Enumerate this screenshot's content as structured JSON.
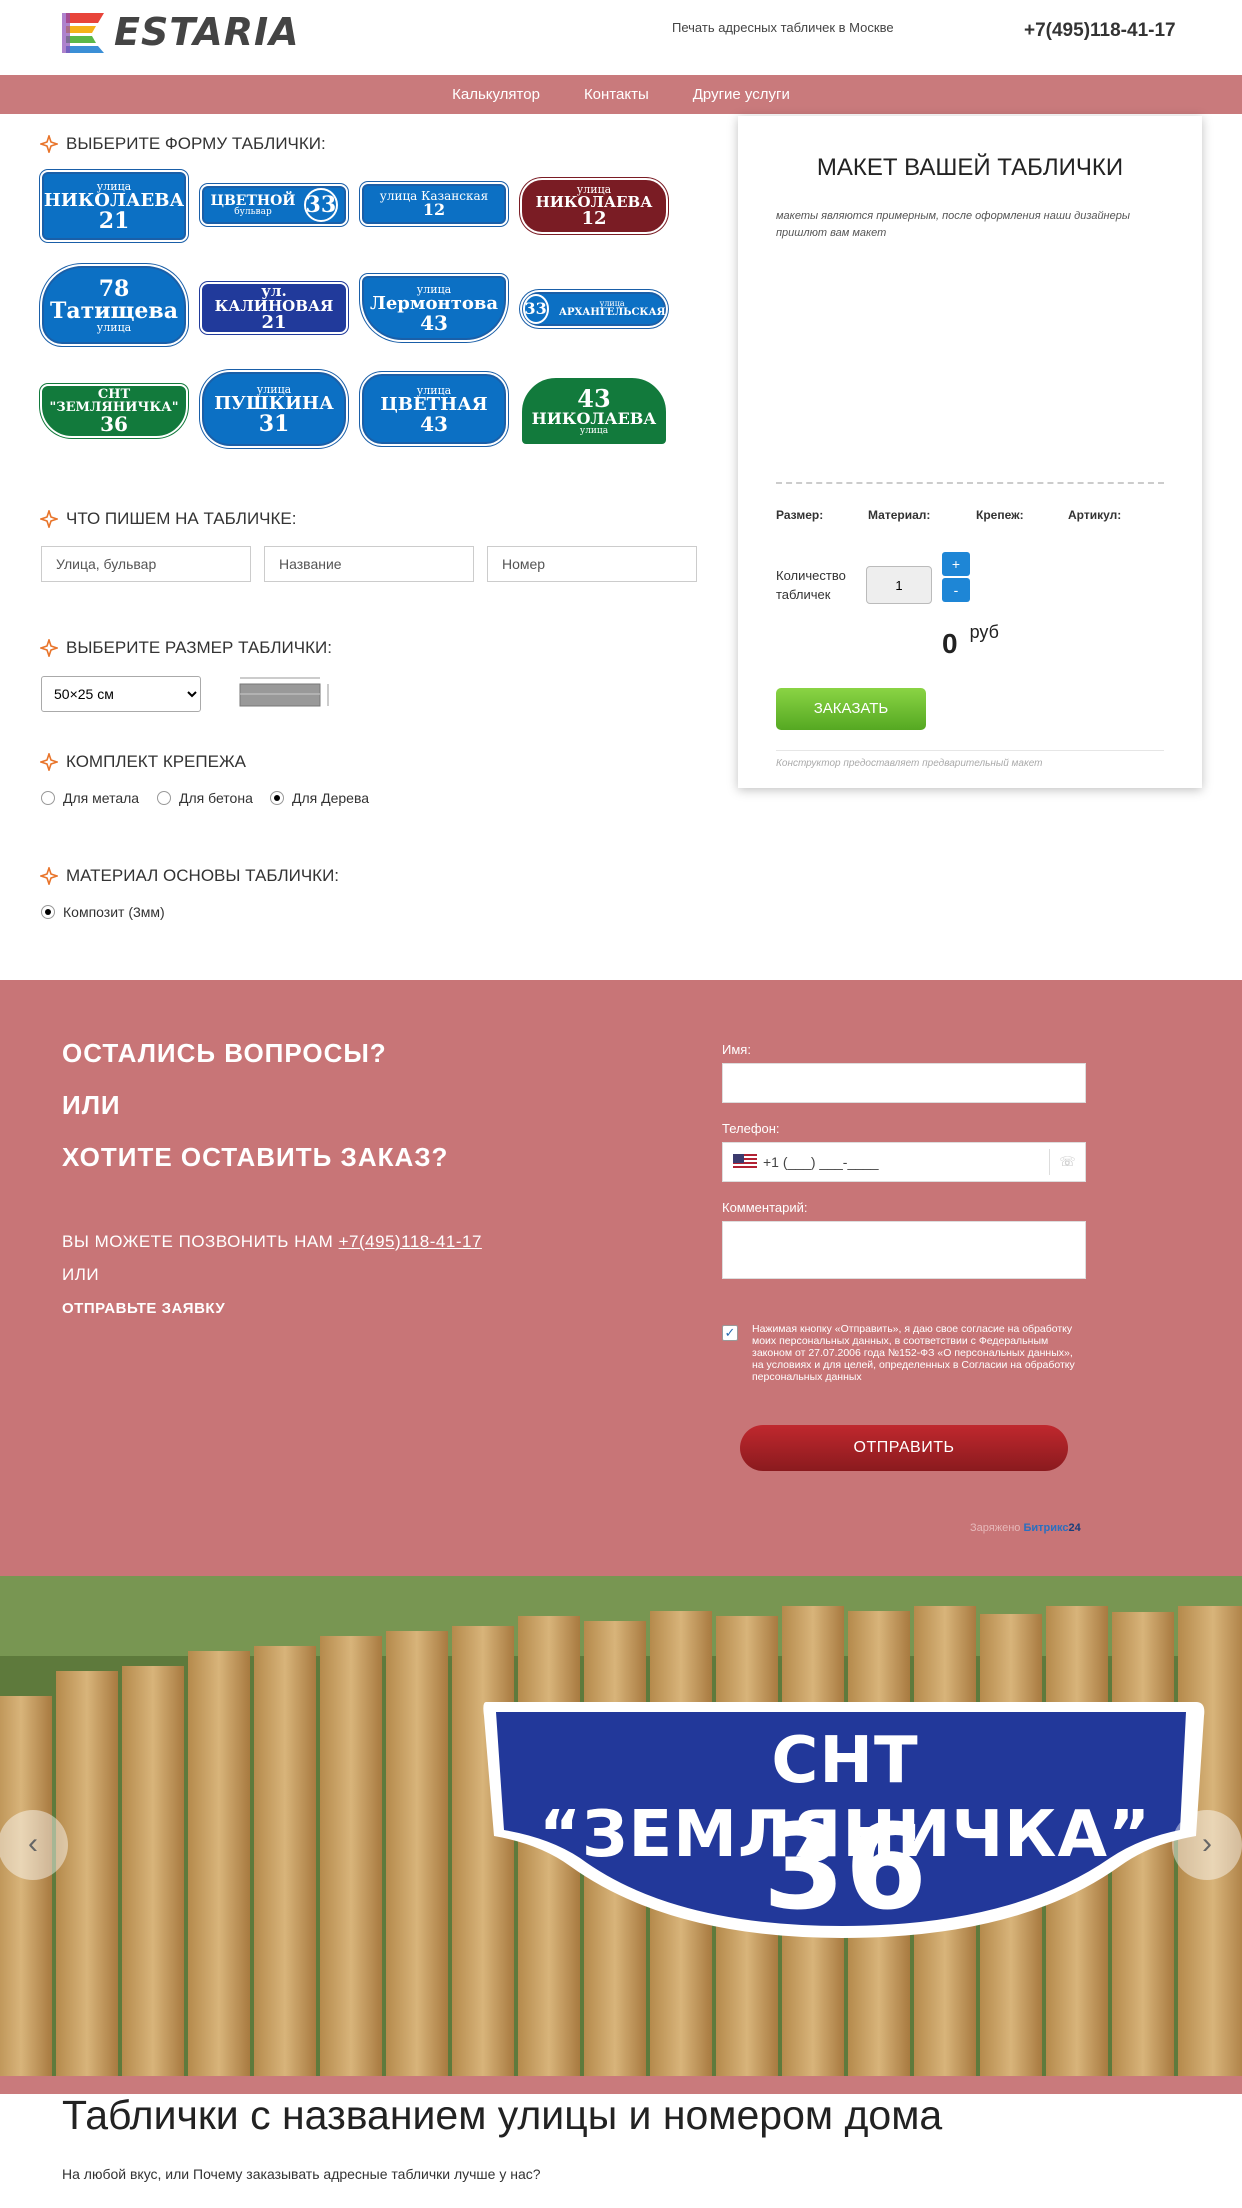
{
  "header": {
    "logo_text": "ESTARIA",
    "tagline": "Печать адресных табличек в Москве",
    "phone": "+7(495)118-41-17"
  },
  "nav": {
    "items": [
      "Калькулятор",
      "Контакты",
      "Другие услуги"
    ]
  },
  "shape_section": {
    "title": "ВЫБЕРИТЕ ФОРМУ ТАБЛИЧКИ:",
    "signs": [
      {
        "top": "улица",
        "main": "НИКОЛАЕВА",
        "num": "21"
      },
      {
        "top": "бульвар",
        "main": "ЦВЕТНОЙ",
        "num": "33"
      },
      {
        "top": "улица Казанская",
        "main": "",
        "num": "12"
      },
      {
        "top": "улица",
        "main": "НИКОЛАЕВА",
        "num": "12"
      },
      {
        "top": "78",
        "main": "Татищева",
        "num": "улица"
      },
      {
        "top": "ул. КАЛИНОВАЯ",
        "main": "",
        "num": "21"
      },
      {
        "top": "улица",
        "main": "Лермонтова",
        "num": "43"
      },
      {
        "top": "улица",
        "main": "АРХАНГЕЛЬСКАЯ",
        "num": "33"
      },
      {
        "top": "СНТ \"ЗЕМЛЯНИЧКА\"",
        "main": "",
        "num": "36"
      },
      {
        "top": "улица",
        "main": "ПУШКИНА",
        "num": "31"
      },
      {
        "top": "улица",
        "main": "ЦВЕТНАЯ",
        "num": "43"
      },
      {
        "top": "43",
        "main": "НИКОЛАЕВА",
        "num": "улица"
      }
    ]
  },
  "text_section": {
    "title": "ЧТО ПИШЕМ НА ТАБЛИЧКЕ:",
    "street_placeholder": "Улица, бульвар",
    "name_placeholder": "Название",
    "number_placeholder": "Номер"
  },
  "size_section": {
    "title": "ВЫБЕРИТЕ РАЗМЕР ТАБЛИЧКИ:",
    "selected": "50×25 см"
  },
  "mount_section": {
    "title": "КОМПЛЕКТ КРЕПЕЖА",
    "options": [
      "Для метала",
      "Для бетона",
      "Для Дерева"
    ],
    "selected": "Для Дерева"
  },
  "material_section": {
    "title": "МАТЕРИАЛ ОСНОВЫ ТАБЛИЧКИ:",
    "options": [
      "Композит (3мм)"
    ]
  },
  "preview": {
    "title": "МАКЕТ ВАШЕЙ ТАБЛИЧКИ",
    "note": "макеты являются примерным, после оформления наши дизайнеры пришлют вам макет",
    "spec_size": "Размер:",
    "spec_material": "Материал:",
    "spec_mount": "Крепеж:",
    "spec_article": "Артикул:",
    "qty_label": "Количество табличек",
    "qty_value": "1",
    "plus": "+",
    "minus": "-",
    "price": "0",
    "currency": "руб",
    "order_button": "ЗАКАЗАТЬ",
    "footnote": "Конструктор предоставляет предварительный макет"
  },
  "contact": {
    "q1": "ОСТАЛИСЬ ВОПРОСЫ?",
    "q2": "ИЛИ",
    "q3": "ХОТИТЕ ОСТАВИТЬ ЗАКАЗ?",
    "call_prefix": "ВЫ МОЖЕТЕ ПОЗВОНИТЬ НАМ",
    "call_phone": "+7(495)118-41-17",
    "or": "ИЛИ",
    "send_request": "ОТПРАВЬТЕ ЗАЯВКУ",
    "name_label": "Имя:",
    "phone_label": "Телефон:",
    "phone_mask": "+1 (___) ___-____",
    "comment_label": "Комментарий:",
    "consent": "Нажимая кнопку «Отправить», я даю свое согласие на обработку моих персональных данных, в соответствии с Федеральным законом от 27.07.2006 года №152-ФЗ «О персональных данных», на условиях и для целей, определенных в Согласии на обработку персональных данных",
    "send_button": "ОТПРАВИТЬ",
    "powered_prefix": "Заряжено",
    "powered_brand": "Битрикс",
    "powered_num": "24"
  },
  "hero": {
    "sign_line1": "СНТ “ЗЕМЛЯНИЧКА”",
    "sign_line2": "36",
    "prev": "‹",
    "next": "›"
  },
  "bottom": {
    "title": "Таблички с названием улицы и номером дома",
    "subtitle": "На любой вкус, или Почему заказывать адресные таблички лучше у нас?"
  }
}
